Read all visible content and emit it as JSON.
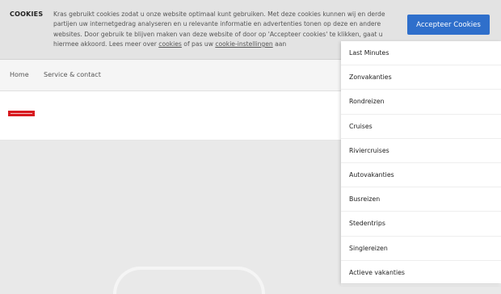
{
  "cookie": {
    "title": "COOKIES",
    "text_before_link1": "Kras gebruikt cookies zodat u onze website optimaal kunt gebruiken. Met deze cookies kunnen wij en derde partijen uw internetgedrag analyseren en u relevante informatie en advertenties tonen op deze en andere websites. Door gebruik te blijven maken van deze website of door op 'Accepteer cookies' te klikken, gaat u hiermee akkoord. Lees meer over ",
    "link1": "cookies",
    "text_between_links": " of pas uw ",
    "link2": "cookie-instellingen",
    "text_after_link2": " aan",
    "accept_label": "Accepteer Cookies"
  },
  "topnav": {
    "home": "Home",
    "service": "Service & contact"
  },
  "dropdown": {
    "items": [
      "Last Minutes",
      "Zonvakanties",
      "Rondreizen",
      "Cruises",
      "Riviercruises",
      "Autovakanties",
      "Busreizen",
      "Stedentrips",
      "Singlereizen",
      "Actieve vakanties"
    ]
  },
  "colors": {
    "accent": "#2f6fcb",
    "logo": "#d7191f"
  }
}
